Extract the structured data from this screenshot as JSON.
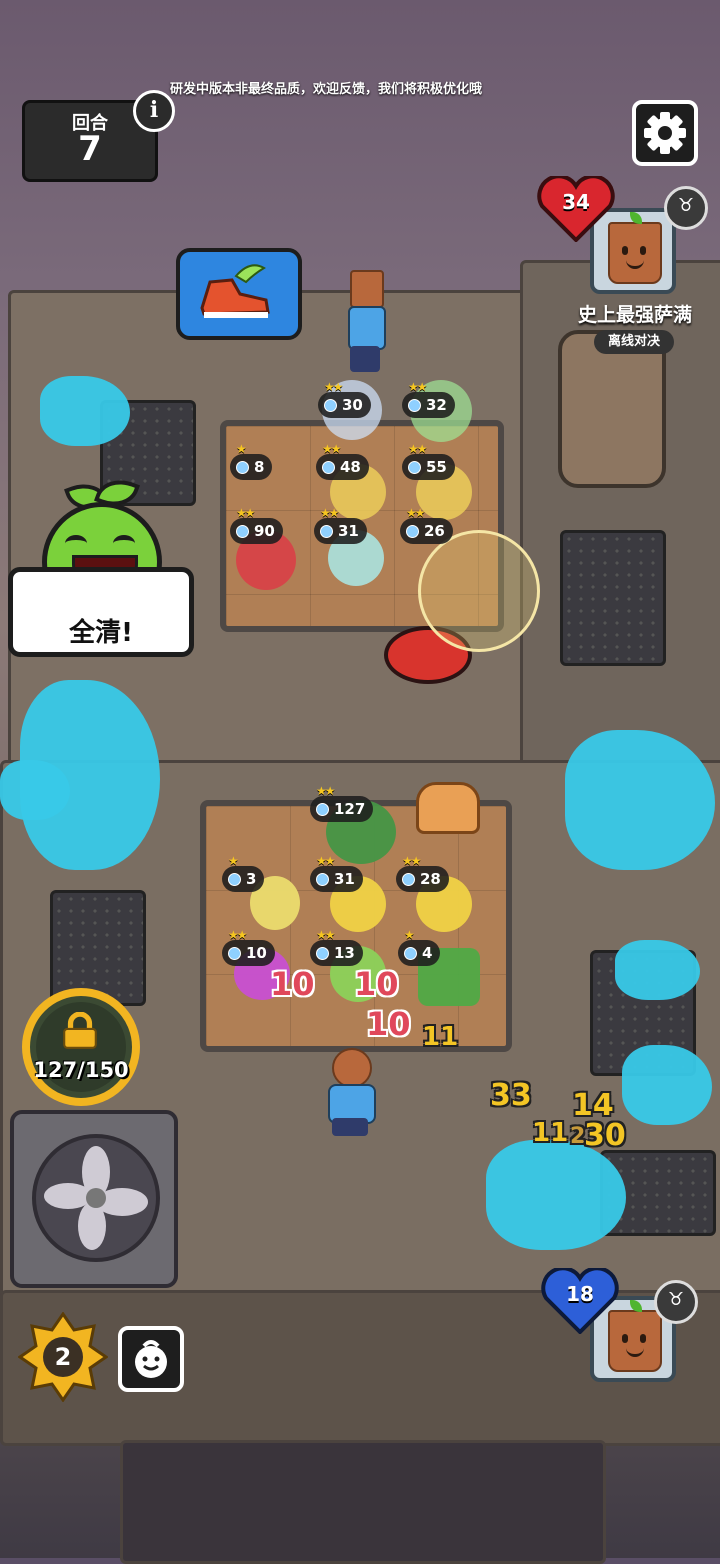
{
  "notice": "研发中版本非最终品质，欢迎反馈，我们将积极优化哦",
  "round": {
    "label": "回合",
    "number": "7"
  },
  "info_icon_text": "i",
  "icons": {
    "settings": "gear-icon",
    "info": "info-icon",
    "badge": "bull-head-icon",
    "lock": "lock-icon",
    "emote": "smiley-icon",
    "item": "winged-shoe-icon"
  },
  "opponent": {
    "health": "34",
    "name": "史上最强萨满",
    "mode": "离线对决"
  },
  "player": {
    "health": "18",
    "level": "2"
  },
  "clear_banner": "全清!",
  "unlock_progress": "127/150",
  "enemy_units": [
    {
      "value": "30",
      "stars": "★★"
    },
    {
      "value": "32",
      "stars": "★★"
    },
    {
      "value": "8",
      "stars": "★"
    },
    {
      "value": "48",
      "stars": "★★"
    },
    {
      "value": "55",
      "stars": "★★"
    },
    {
      "value": "90",
      "stars": "★★"
    },
    {
      "value": "31",
      "stars": "★★"
    },
    {
      "value": "26",
      "stars": "★★"
    }
  ],
  "player_units": [
    {
      "value": "127",
      "stars": "★★"
    },
    {
      "value": "3",
      "stars": "★"
    },
    {
      "value": "31",
      "stars": "★★"
    },
    {
      "value": "28",
      "stars": "★★"
    },
    {
      "value": "10",
      "stars": "★★"
    },
    {
      "value": "13",
      "stars": "★★"
    },
    {
      "value": "4",
      "stars": "★"
    }
  ],
  "damage_numbers": [
    "10",
    "10",
    "10",
    "11",
    "33",
    "14",
    "11",
    "2",
    "30"
  ],
  "colors": {
    "splash": "#38c9e8",
    "heart_red": "#d9262e",
    "heart_blue": "#2d5fd8",
    "damage_red": "#e0485b",
    "damage_yellow": "#f3c525",
    "ring": "#f2b521"
  }
}
